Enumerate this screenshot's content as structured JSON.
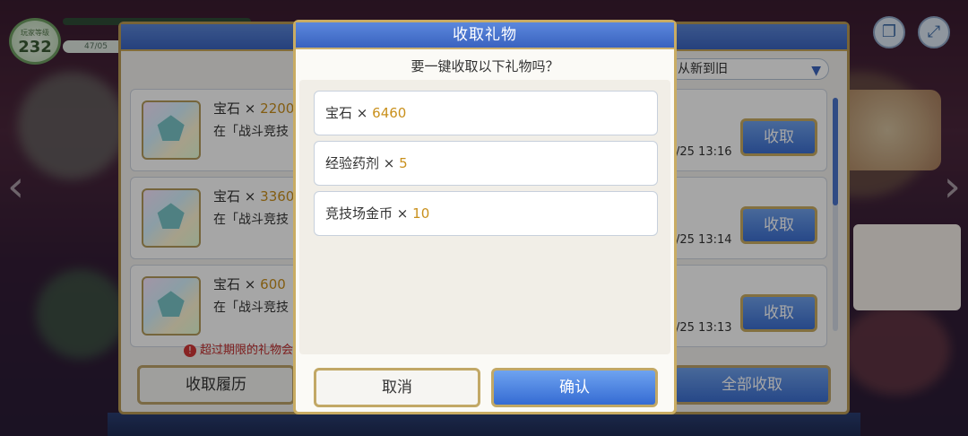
{
  "player": {
    "level_label": "玩家等级",
    "level": "232",
    "stamina_text": "47/05"
  },
  "gift_window": {
    "sort_label": "从新到旧",
    "gifts": [
      {
        "name": "宝石",
        "times": "×",
        "amount": "2200",
        "desc": "在「战斗竞技",
        "date": "/25  13:16",
        "claim_label": "收取"
      },
      {
        "name": "宝石",
        "times": "×",
        "amount": "3360",
        "desc": "在「战斗竞技",
        "date": "/25  13:14",
        "claim_label": "收取"
      },
      {
        "name": "宝石",
        "times": "×",
        "amount": "600",
        "desc": "在「战斗竞技",
        "date": "/25  13:13",
        "claim_label": "收取"
      }
    ],
    "expire_note": "超过期限的礼物会",
    "history_label": "收取履历",
    "claim_all_label": "全部收取"
  },
  "modal": {
    "title": "收取礼物",
    "question": "要一键收取以下礼物吗？",
    "items": [
      {
        "name": "宝石",
        "times": "×",
        "amount": "6460"
      },
      {
        "name": "经验药剂",
        "times": "×",
        "amount": "5"
      },
      {
        "name": "竞技场金币",
        "times": "×",
        "amount": "10"
      }
    ],
    "cancel_label": "取消",
    "confirm_label": "确认"
  },
  "colors": {
    "accent_blue": "#3c6fd1",
    "gold_border": "#c9ac63",
    "amount_gold": "#c9901c"
  }
}
